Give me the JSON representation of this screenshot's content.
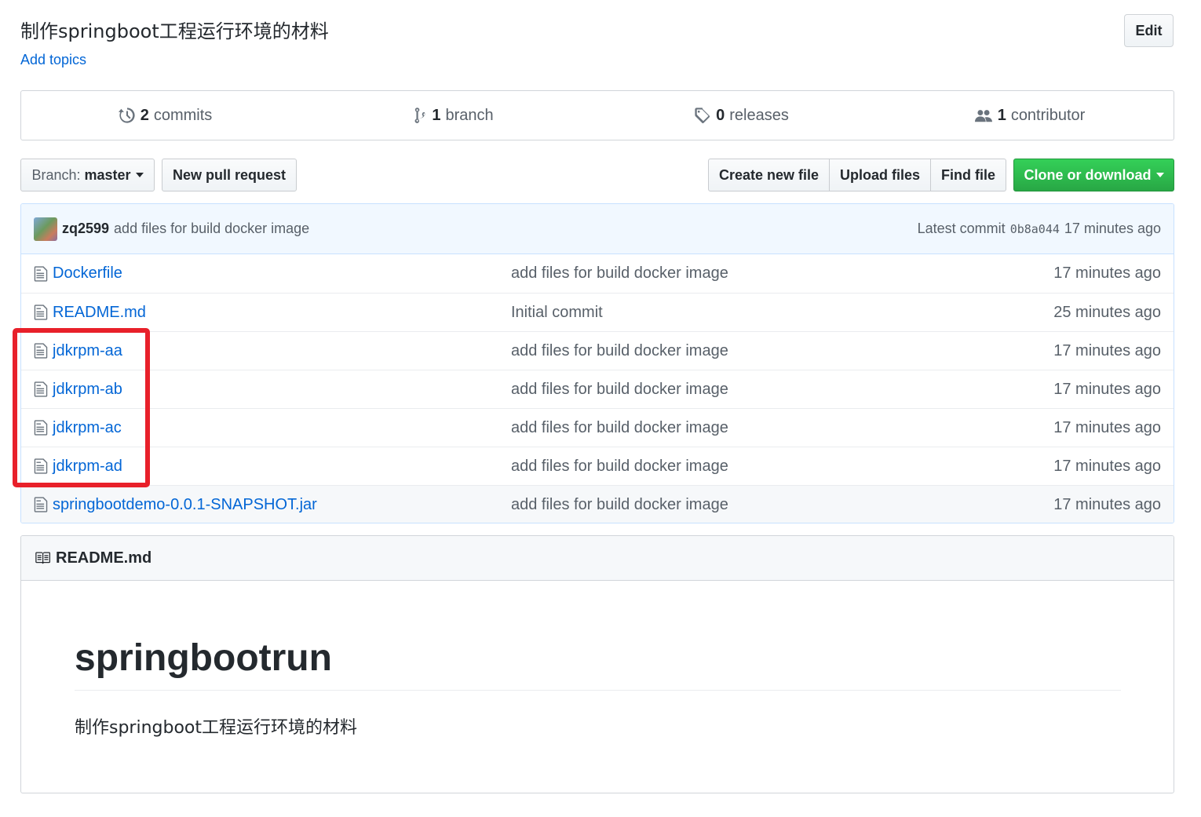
{
  "repo": {
    "description": "制作springboot工程运行环境的材料",
    "add_topics": "Add topics",
    "edit_label": "Edit"
  },
  "summary": {
    "commits_count": "2",
    "commits_label": "commits",
    "branches_count": "1",
    "branches_label": "branch",
    "releases_count": "0",
    "releases_label": "releases",
    "contributors_count": "1",
    "contributors_label": "contributor"
  },
  "toolbar": {
    "branch_prefix": "Branch:",
    "branch_name": "master",
    "new_pr": "New pull request",
    "create_file": "Create new file",
    "upload_files": "Upload files",
    "find_file": "Find file",
    "clone": "Clone or download"
  },
  "latest_commit": {
    "author": "zq2599",
    "message": "add files for build docker image",
    "label": "Latest commit",
    "sha": "0b8a044",
    "age": "17 minutes ago"
  },
  "files": [
    {
      "name": "Dockerfile",
      "message": "add files for build docker image",
      "age": "17 minutes ago"
    },
    {
      "name": "README.md",
      "message": "Initial commit",
      "age": "25 minutes ago"
    },
    {
      "name": "jdkrpm-aa",
      "message": "add files for build docker image",
      "age": "17 minutes ago"
    },
    {
      "name": "jdkrpm-ab",
      "message": "add files for build docker image",
      "age": "17 minutes ago"
    },
    {
      "name": "jdkrpm-ac",
      "message": "add files for build docker image",
      "age": "17 minutes ago"
    },
    {
      "name": "jdkrpm-ad",
      "message": "add files for build docker image",
      "age": "17 minutes ago"
    },
    {
      "name": "springbootdemo-0.0.1-SNAPSHOT.jar",
      "message": "add files for build docker image",
      "age": "17 minutes ago"
    }
  ],
  "readme": {
    "filename": "README.md",
    "heading": "springbootrun",
    "body": "制作springboot工程运行环境的材料"
  },
  "colors": {
    "link": "#0366d6",
    "clone_button": "#28a745",
    "highlight_box": "#e8202a",
    "commit_bar": "#f1f8ff"
  }
}
